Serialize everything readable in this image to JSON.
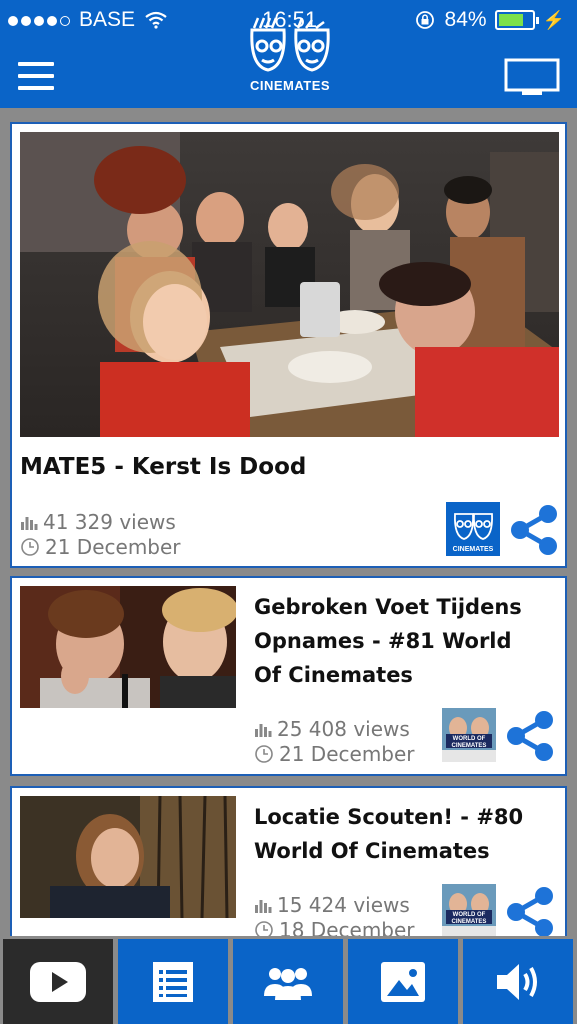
{
  "status_bar": {
    "carrier": "BASE",
    "time": "16:51",
    "battery": "84%",
    "battery_level": 0.84,
    "signal_bars": 4
  },
  "header": {
    "logo_text": "CINEMATES"
  },
  "videos": [
    {
      "title": "MATE5 - Kerst Is Dood",
      "views": "41 329 views",
      "date": "21 December",
      "channel": "Cinemates"
    },
    {
      "title": "Gebroken Voet Tijdens Opnames - #81 World Of Cinemates",
      "views": "25 408 views",
      "date": "21 December",
      "channel": "World of Cinemates"
    },
    {
      "title": "Locatie Scouten! - #80 World Of Cinemates",
      "views": "15 424 views",
      "date": "18 December",
      "channel": "World of Cinemates"
    }
  ],
  "channel_logos": {
    "cinemates": "CINEMATES",
    "world_top": "WORLD OF",
    "world_bottom": "CINEMATES"
  },
  "tabs": [
    "video",
    "list",
    "people",
    "images",
    "audio"
  ],
  "colors": {
    "brand_blue": "#0a64c8",
    "active_tab": "#2b2b2b",
    "share_blue": "#1e73d8",
    "meta_gray": "#777777"
  }
}
